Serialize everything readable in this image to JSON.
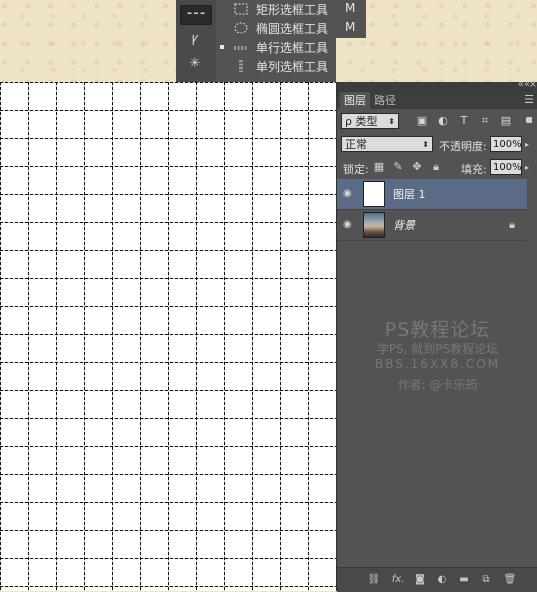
{
  "toolbar": {
    "tools": [
      {
        "name": "single-row-marquee-tool-icon",
        "glyph": "⁃⁃⁃",
        "active": true
      },
      {
        "name": "lasso-tool-icon",
        "glyph": "ꝩ"
      },
      {
        "name": "magic-wand-tool-icon",
        "glyph": "✳"
      }
    ]
  },
  "flyout": {
    "items": [
      {
        "label": "矩形选框工具",
        "key": "M",
        "icon": "rect-marquee-icon",
        "selected": false
      },
      {
        "label": "椭圆选框工具",
        "key": "M",
        "icon": "ellipse-marquee-icon",
        "selected": false
      },
      {
        "label": "单行选框工具",
        "key": "",
        "icon": "single-row-marquee-icon",
        "selected": true
      },
      {
        "label": "单列选框工具",
        "key": "",
        "icon": "single-column-marquee-icon",
        "selected": false
      }
    ]
  },
  "panel": {
    "tabs": [
      "图层",
      "路径"
    ],
    "filter_type": "ρ 类型",
    "blend_mode": "正常",
    "opacity_label": "不透明度:",
    "opacity_value": "100%",
    "lock_label": "锁定:",
    "fill_label": "填充:",
    "fill_value": "100%",
    "layers": [
      {
        "name": "图层 1",
        "thumb": "white",
        "selected": true,
        "locked": false
      },
      {
        "name": "背景",
        "thumb": "photo",
        "selected": false,
        "locked": true
      }
    ]
  },
  "watermark": {
    "title": "PS教程论坛",
    "subtitle": "学PS, 就到PS教程论坛",
    "url": "BBS.16XX8.COM",
    "author": "作者: @卡乐筠"
  }
}
